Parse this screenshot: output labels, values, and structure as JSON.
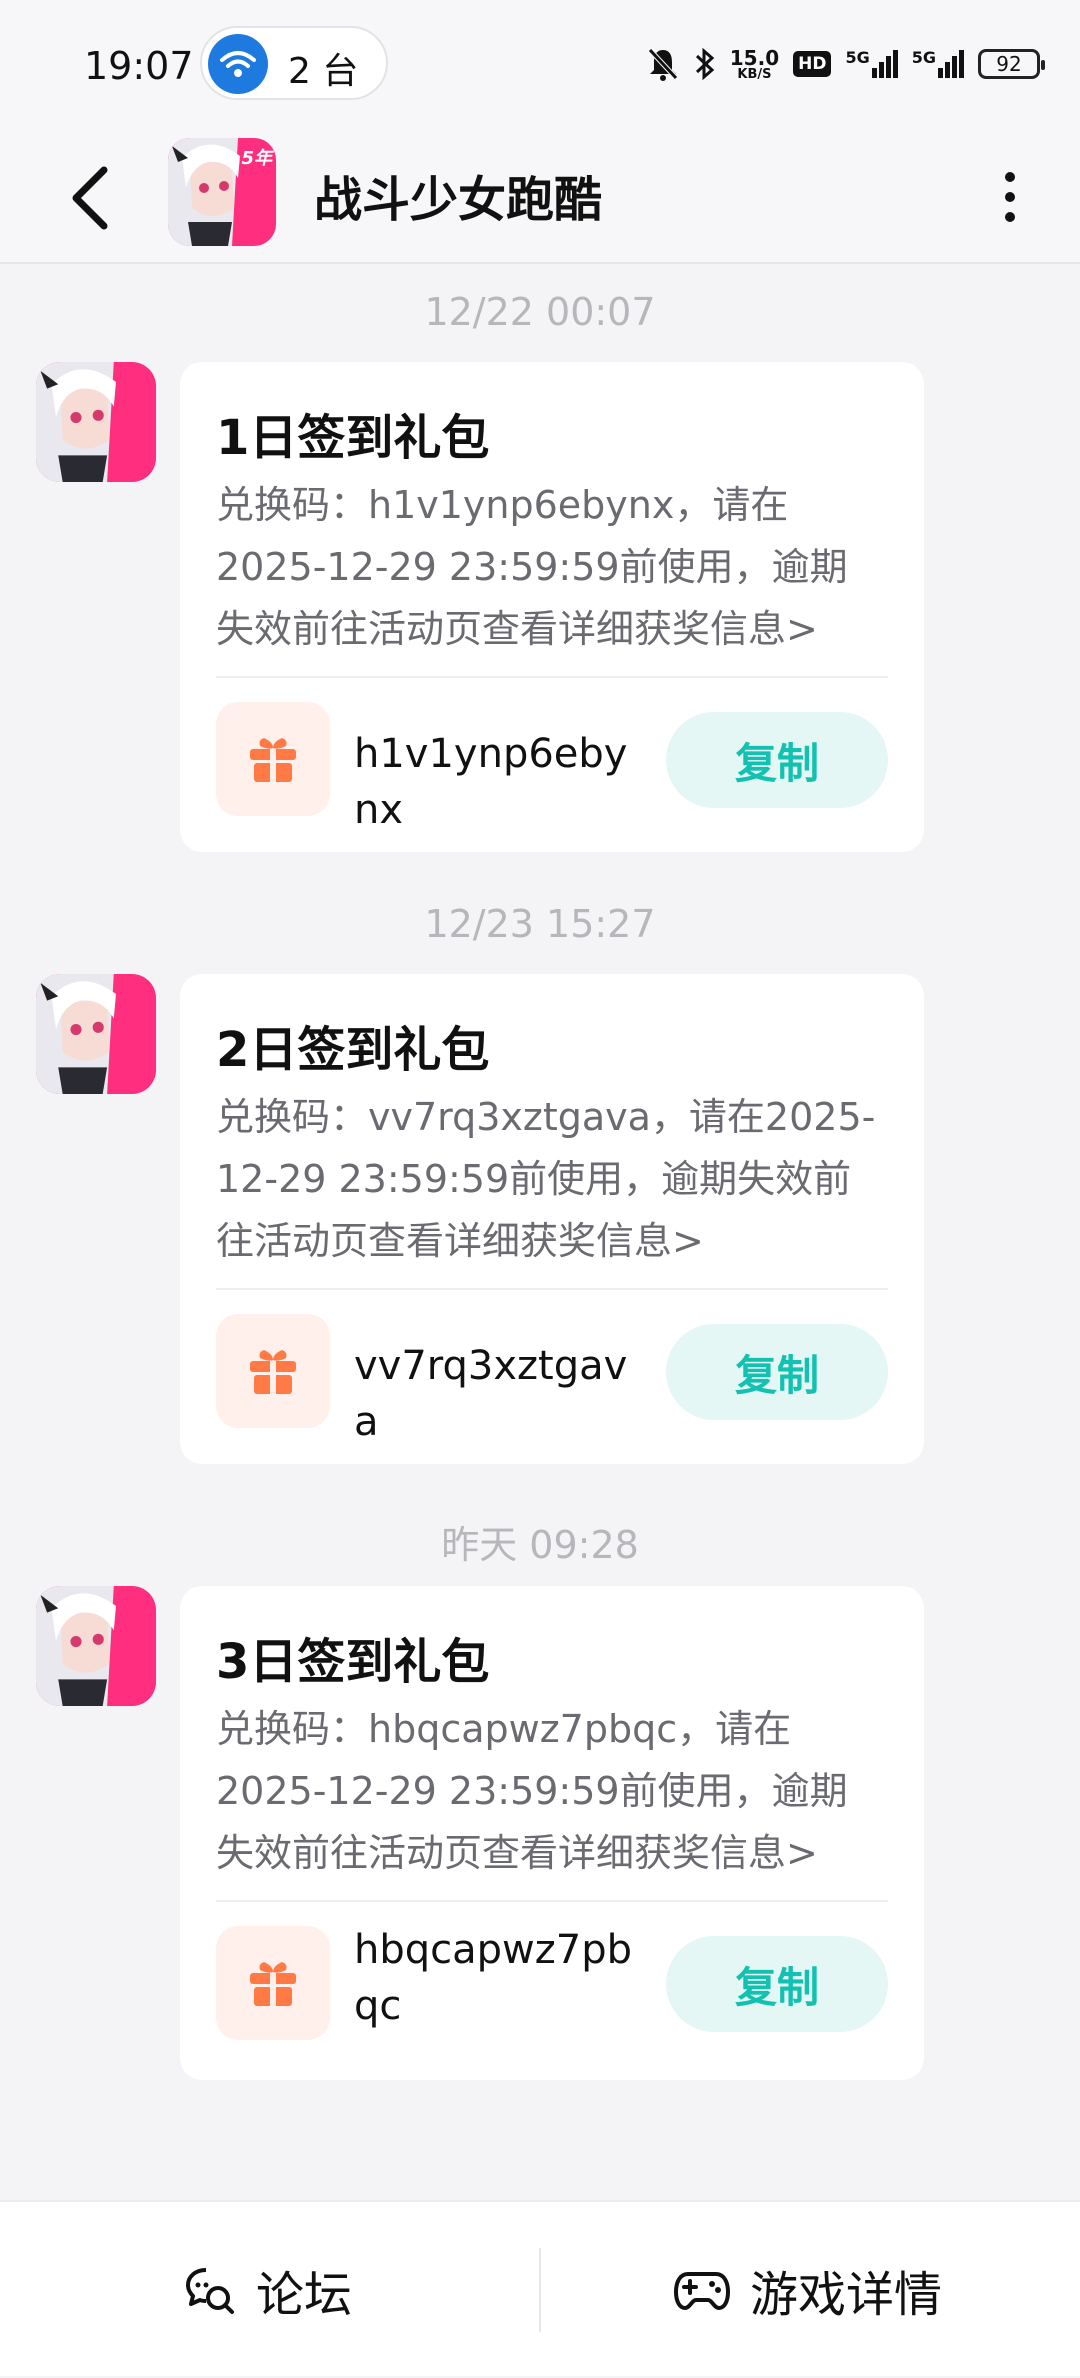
{
  "status_bar": {
    "time": "19:07",
    "hotspot_count": "2 台",
    "net_speed": "15.0",
    "net_speed_unit": "KB/S",
    "hd_label": "HD",
    "sim1": "5G",
    "sim2": "5G",
    "battery": "92"
  },
  "header": {
    "title": "战斗少女跑酷",
    "avatar_badge": "5年"
  },
  "messages": [
    {
      "timestamp": "12/22  00:07",
      "title": "1日签到礼包",
      "body": "兑换码：h1v1ynp6ebynx，请在2025-12-29 23:59:59前使用，逾期失效前往活动页查看详细获奖信息>",
      "code": "h1v1ynp6ebynx",
      "copy_label": "复制"
    },
    {
      "timestamp": "12/23  15:27",
      "title": "2日签到礼包",
      "body": "兑换码：vv7rq3xztgava，请在2025-12-29 23:59:59前使用，逾期失效前往活动页查看详细获奖信息>",
      "code": "vv7rq3xztgava",
      "copy_label": "复制"
    },
    {
      "timestamp": "昨天  09:28",
      "title": "3日签到礼包",
      "body": "兑换码：hbqcapwz7pbqc，请在2025-12-29 23:59:59前使用，逾期失效前往活动页查看详细获奖信息>",
      "code": "hbqcapwz7pbqc",
      "copy_label": "复制"
    }
  ],
  "bottom_bar": {
    "forum_label": "论坛",
    "game_details_label": "游戏详情"
  },
  "colors": {
    "accent": "#12c1b0",
    "copy_bg": "#e4f7f5",
    "gift": "#ff7a45",
    "gift_bg": "#fff0ec",
    "avatar_pink": "#ff2e7e"
  }
}
